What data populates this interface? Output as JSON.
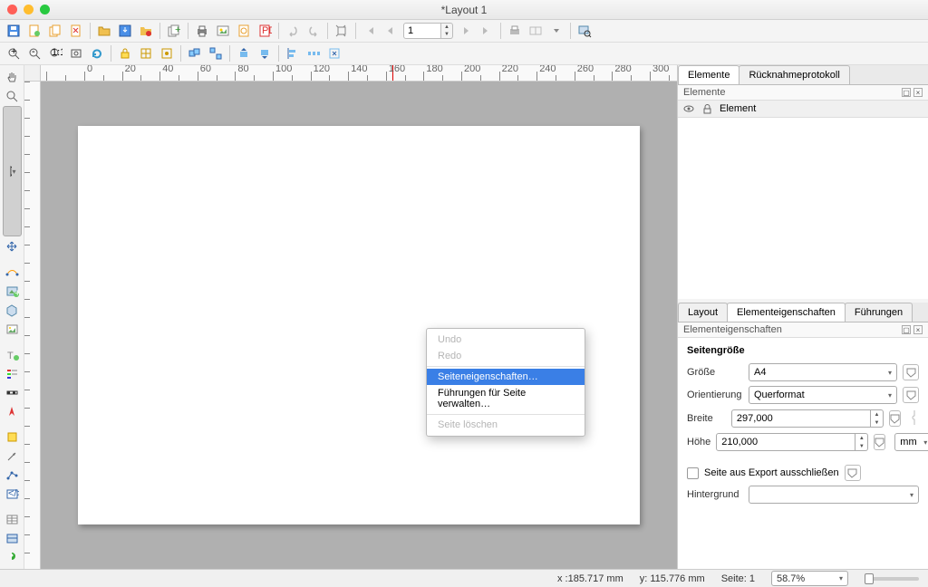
{
  "window": {
    "title": "*Layout 1"
  },
  "toolbar1_spin": "1",
  "context_menu": {
    "undo": "Undo",
    "redo": "Redo",
    "page_props": "Seiteneigenschaften…",
    "manage_guides": "Führungen für Seite verwalten…",
    "delete_page": "Seite löschen"
  },
  "right": {
    "tabs_top": {
      "elements": "Elemente",
      "undo_log": "Rücknahmeprotokoll"
    },
    "panel_elements": "Elemente",
    "tree_header": "Element",
    "tabs_bottom": {
      "layout": "Layout",
      "item_props": "Elementeigenschaften",
      "guides": "Führungen"
    },
    "panel_item_props": "Elementeigenschaften",
    "section_pagesize": "Seitengröße",
    "lbl_size": "Größe",
    "val_size": "A4",
    "lbl_orient": "Orientierung",
    "val_orient": "Querformat",
    "lbl_width": "Breite",
    "val_width": "297,000",
    "lbl_height": "Höhe",
    "val_height": "210,000",
    "unit": "mm",
    "chk_exclude": "Seite aus Export ausschließen",
    "lbl_bg": "Hintergrund"
  },
  "status": {
    "x": "x :185.717 mm",
    "y": "y: 115.776 mm",
    "page": "Seite: 1",
    "zoom": "58.7%"
  }
}
